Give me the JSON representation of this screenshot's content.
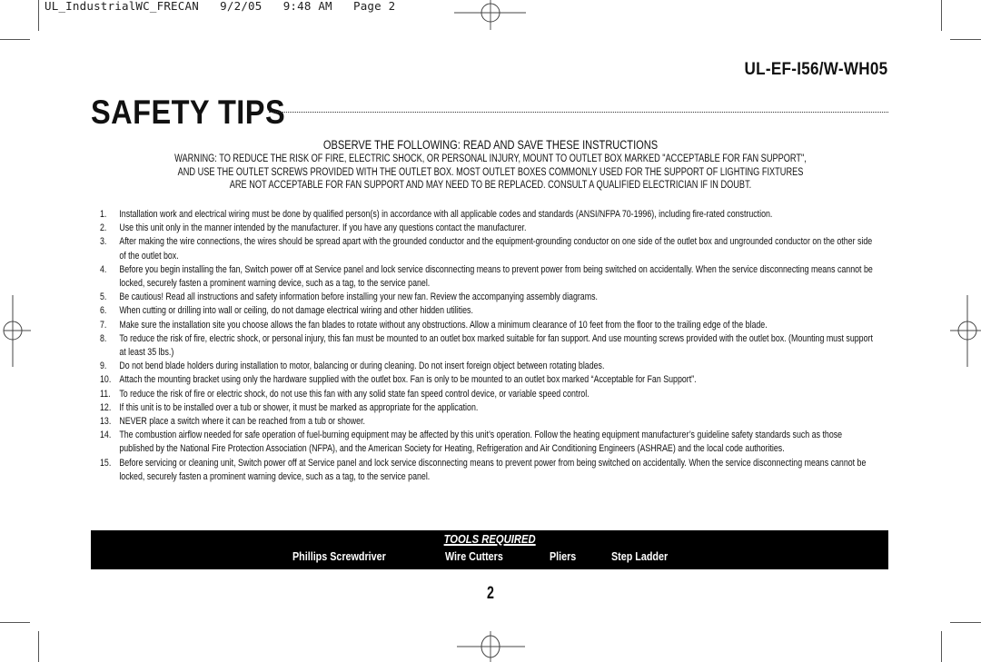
{
  "slug": {
    "file": "UL_IndustrialWC_FRECAN",
    "date": "9/2/05",
    "time": "9:48 AM",
    "page_label": "Page 2"
  },
  "model_number": "UL-EF-I56/W-WH05",
  "title": "SAFETY TIPS",
  "observe_heading": "OBSERVE THE FOLLOWING: READ AND SAVE THESE INSTRUCTIONS",
  "warning_lines": [
    "WARNING: TO REDUCE THE RISK OF FIRE, ELECTRIC SHOCK, OR PERSONAL INJURY, MOUNT TO OUTLET BOX MARKED \"ACCEPTABLE FOR FAN SUPPORT\",",
    "AND USE THE OUTLET SCREWS PROVIDED WITH THE OUTLET BOX. MOST OUTLET BOXES COMMONLY USED FOR THE SUPPORT OF LIGHTING FIXTURES",
    "ARE NOT ACCEPTABLE FOR FAN SUPPORT AND MAY NEED TO BE REPLACED. CONSULT A QUALIFIED ELECTRICIAN IF IN DOUBT."
  ],
  "tips": [
    {
      "num": "1.",
      "text": "Installation work and electrical wiring must be done by qualified person(s) in accordance with all applicable codes and standards (ANSI/NFPA 70-1996), including fire-rated construction."
    },
    {
      "num": "2.",
      "text": "Use this unit only in the manner intended by the manufacturer.  If you have  any questions contact the manufacturer."
    },
    {
      "num": "3.",
      "text": "After making the wire connections, the wires should be spread apart with the grounded conductor and the equipment-grounding conductor on one side of the outlet box and ungrounded conductor on the other side of the outlet box."
    },
    {
      "num": "4.",
      "text": "Before you begin installing the fan, Switch power off at Service panel and lock service disconnecting means to prevent power from being switched on accidentally.  When the service disconnecting means cannot be locked, securely fasten a prominent warning device, such  as a tag, to the service panel."
    },
    {
      "num": "5.",
      "text": "Be cautious! Read all instructions and safety information before installing your new fan. Review the accompanying assembly diagrams."
    },
    {
      "num": "6.",
      "text": "When cutting or drilling into wall or ceiling, do not damage electrical wiring and other hidden utilities."
    },
    {
      "num": "7.",
      "text": "Make sure the installation site you choose allows the fan blades to rotate without any obstructions. Allow a minimum clearance of 10 feet from the floor to the trailing edge of the blade."
    },
    {
      "num": "8.",
      "text": "To reduce the risk of fire, electric shock, or personal injury, this fan must be mounted to an outlet box marked suitable for fan support.  And use mounting screws provided with the outlet box. (Mounting must support at least 35 lbs.)"
    },
    {
      "num": "9.",
      "text": "Do not bend blade holders during installation to motor, balancing or during cleaning.  Do not insert foreign object between rotating blades."
    },
    {
      "num": "10.",
      "text": "Attach the mounting bracket using only the hardware supplied with the outlet box. Fan is only to be mounted to an outlet box marked “Acceptable for Fan Support”."
    },
    {
      "num": "11.",
      "text": "To reduce the risk of fire or electric shock, do not use this fan with any solid state fan speed control device, or variable speed control."
    },
    {
      "num": "12.",
      "text": "If this unit is to be installed over a tub or shower, it must be marked as appropriate for the application."
    },
    {
      "num": "13.",
      "text": "NEVER place a switch where it can be reached from a tub or shower."
    },
    {
      "num": "14.",
      "text": "The combustion airflow needed for safe operation of fuel-burning equipment may be affected by this unit’s operation. Follow the heating equipment manufacturer’s guideline safety standards such as those published by the National Fire Protection Association (NFPA), and the American Society for Heating, Refrigeration and Air Conditioning Engineers (ASHRAE) and the local code authorities."
    },
    {
      "num": "15.",
      "text": "Before servicing or cleaning unit, Switch power off at Service panel and lock service disconnecting means to prevent power from being switched on accidentally.  When the service disconnecting means cannot be locked, securely fasten a prominent warning device, such  as a tag, to the service panel."
    }
  ],
  "tools": {
    "heading": "TOOLS REQUIRED",
    "items": [
      "Phillips Screwdriver",
      "Wire Cutters",
      "Pliers",
      "Step Ladder"
    ]
  },
  "page_number": "2"
}
